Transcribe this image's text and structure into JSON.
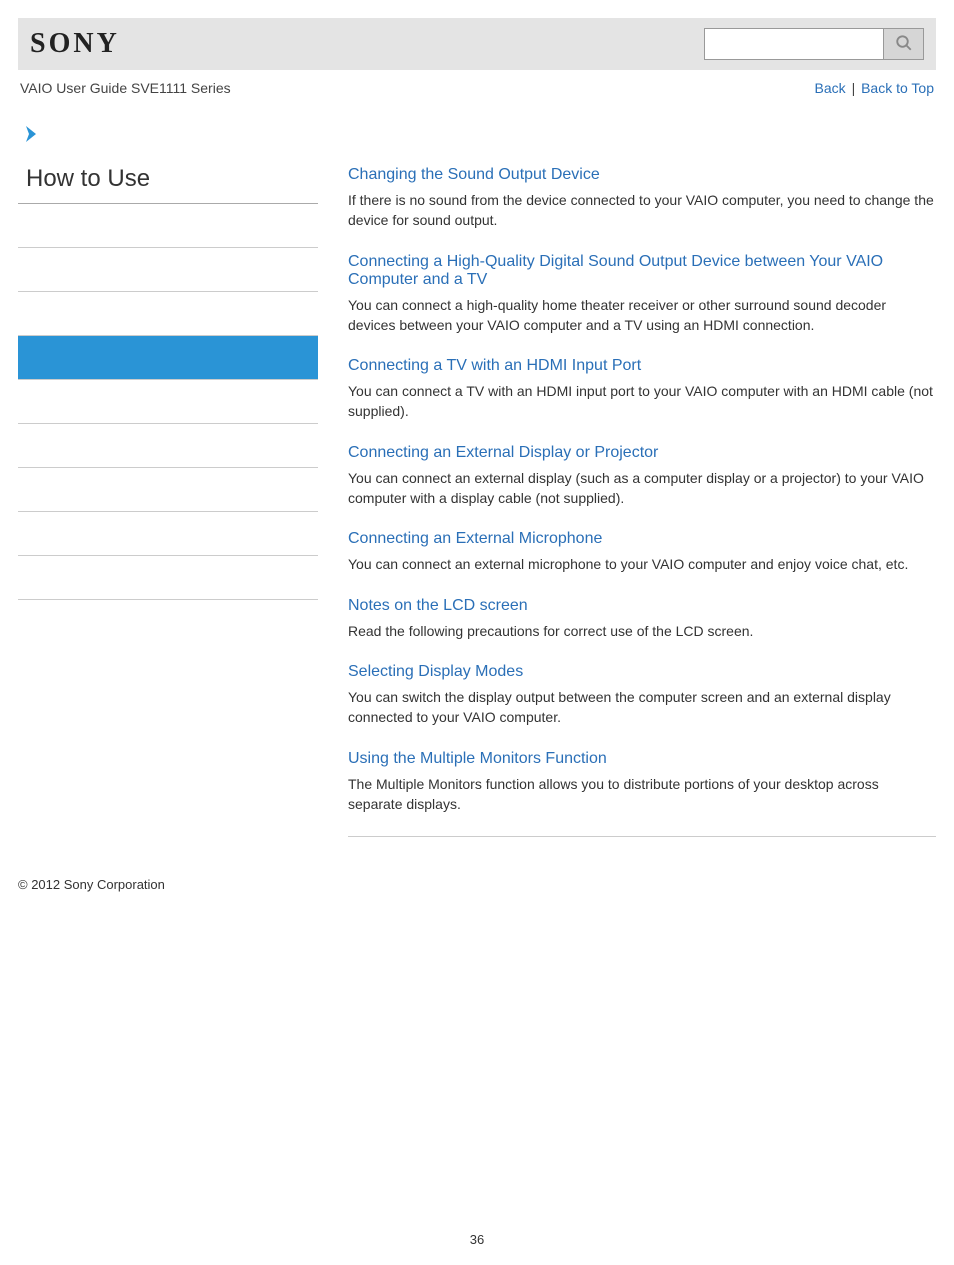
{
  "header": {
    "logo": "SONY",
    "search_placeholder": ""
  },
  "subheader": {
    "guide_title": "VAIO User Guide SVE1111 Series",
    "back_label": "Back",
    "sep": " | ",
    "back_to_top_label": "Back to Top"
  },
  "sidebar": {
    "title": "How to Use",
    "items": [
      {
        "active": false
      },
      {
        "active": false
      },
      {
        "active": false
      },
      {
        "active": true
      },
      {
        "active": false
      },
      {
        "active": false
      },
      {
        "active": false
      },
      {
        "active": false
      },
      {
        "active": false
      }
    ]
  },
  "topics": [
    {
      "title": "Changing the Sound Output Device",
      "desc": "If there is no sound from the device connected to your VAIO computer, you need to change the device for sound output."
    },
    {
      "title": "Connecting a High-Quality Digital Sound Output Device between Your VAIO Computer and a TV",
      "desc": "You can connect a high-quality home theater receiver or other surround sound decoder devices between your VAIO computer and a TV using an HDMI connection."
    },
    {
      "title": "Connecting a TV with an HDMI Input Port",
      "desc": "You can connect a TV with an HDMI input port to your VAIO computer with an HDMI cable (not supplied)."
    },
    {
      "title": "Connecting an External Display or Projector",
      "desc": "You can connect an external display (such as a computer display or a projector) to your VAIO computer with a display cable (not supplied)."
    },
    {
      "title": "Connecting an External Microphone",
      "desc": "You can connect an external microphone to your VAIO computer and enjoy voice chat, etc."
    },
    {
      "title": "Notes on the LCD screen",
      "desc": "Read the following precautions for correct use of the LCD screen."
    },
    {
      "title": "Selecting Display Modes",
      "desc": "You can switch the display output between the computer screen and an external display connected to your VAIO computer."
    },
    {
      "title": "Using the Multiple Monitors Function",
      "desc": "The Multiple Monitors function allows you to distribute portions of your desktop across separate displays."
    }
  ],
  "footer": {
    "copyright": "© 2012 Sony Corporation"
  },
  "page_number": "36"
}
